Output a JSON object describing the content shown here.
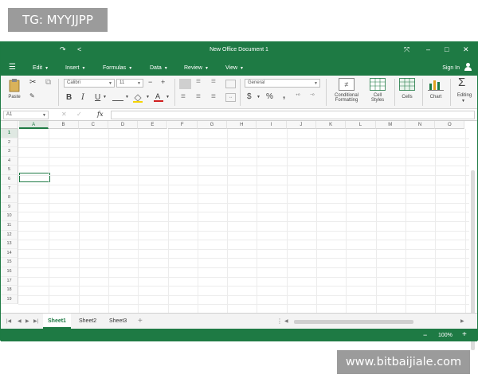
{
  "watermarks": {
    "top": "TG: MYYJJPP",
    "bottom": "www.bitbaijiale.com"
  },
  "window": {
    "title": "New Office Document 1"
  },
  "menu": {
    "items": [
      "Edit",
      "Insert",
      "Formulas",
      "Data",
      "Review",
      "View"
    ],
    "sign_in": "Sign In"
  },
  "ribbon": {
    "paste": "Paste",
    "font_name": "Calibri",
    "font_size": "11",
    "number_format": "General",
    "conditional_formatting": [
      "Conditional",
      "Formatting"
    ],
    "cell_styles": [
      "Cell",
      "Styles"
    ],
    "cells": "Cells",
    "chart": "Chart",
    "editing": "Editing",
    "bold": "B",
    "italic": "I",
    "underline": "U",
    "currency": "$",
    "percent": "%",
    "comma": ","
  },
  "formula_bar": {
    "name_box": "A1",
    "fx": "fx",
    "value": ""
  },
  "grid": {
    "columns": [
      "A",
      "B",
      "C",
      "D",
      "E",
      "F",
      "G",
      "H",
      "I",
      "J",
      "K",
      "L",
      "M",
      "N",
      "O"
    ],
    "rows": [
      "1",
      "2",
      "3",
      "4",
      "5",
      "6",
      "7",
      "8",
      "9",
      "10",
      "11",
      "12",
      "13",
      "14",
      "15",
      "16",
      "17",
      "18",
      "19"
    ],
    "active_cell": "A1"
  },
  "sheets": {
    "tabs": [
      "Sheet1",
      "Sheet2",
      "Sheet3"
    ],
    "active": "Sheet1"
  },
  "status": {
    "zoom": "100%"
  },
  "colors": {
    "accent": "#1e7a44",
    "ribbon_bg": "#f5f5f5"
  }
}
